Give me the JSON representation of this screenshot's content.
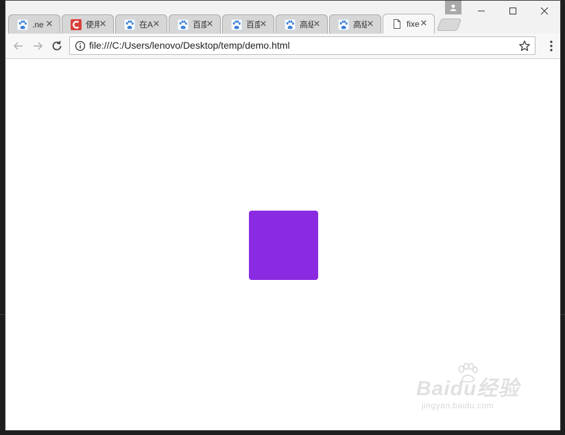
{
  "window": {
    "tabs": [
      {
        "title": ".ne",
        "icon": "baidu-paw-icon",
        "active": false
      },
      {
        "title": "使用",
        "icon": "csdn-icon",
        "active": false
      },
      {
        "title": "在A",
        "icon": "baidu-paw-icon",
        "active": false
      },
      {
        "title": "百度",
        "icon": "baidu-paw-icon",
        "active": false
      },
      {
        "title": "百度",
        "icon": "baidu-paw-icon",
        "active": false
      },
      {
        "title": "高级",
        "icon": "baidu-paw-icon",
        "active": false
      },
      {
        "title": "高级",
        "icon": "baidu-paw-icon",
        "active": false
      },
      {
        "title": "fixe",
        "icon": "page-icon",
        "active": true
      }
    ],
    "tab_close_glyph": "✕",
    "controls": {
      "minimize": "—",
      "maximize": "☐",
      "close": "✕"
    }
  },
  "toolbar": {
    "url": "file:///C:/Users/lenovo/Desktop/temp/demo.html"
  },
  "page": {
    "box_color": "#8a2be2"
  },
  "watermark": {
    "main": "Baidu经验",
    "sub": "jingyan.baidu.com"
  },
  "colors": {
    "accent_csdn": "#d9403a",
    "baidu_blue": "#3b7fdb"
  }
}
